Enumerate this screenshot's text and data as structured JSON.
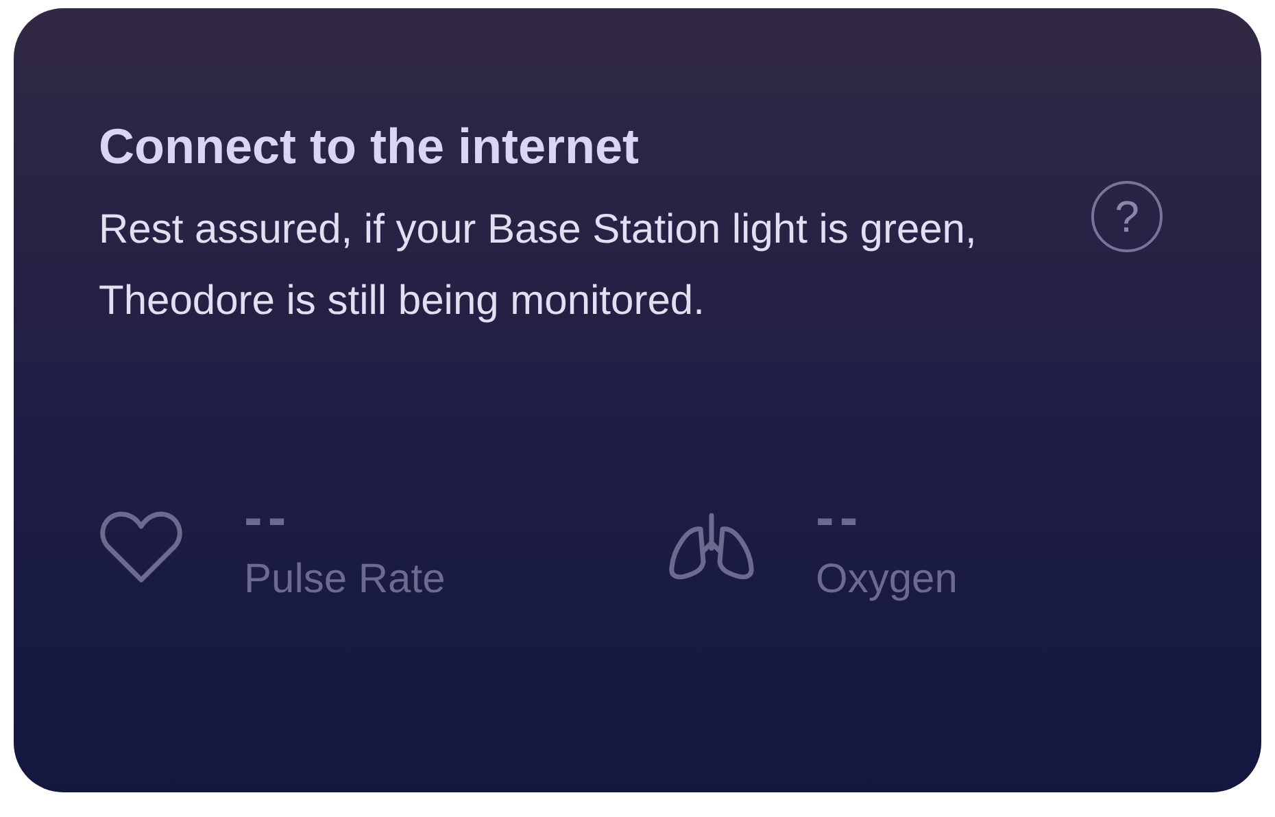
{
  "card": {
    "title": "Connect to the internet",
    "message": "Rest assured, if your Base Station light is green, Theodore is still being monitored.",
    "help_icon": "?"
  },
  "metrics": [
    {
      "kind": "heart",
      "value": "--",
      "label": "Pulse Rate"
    },
    {
      "kind": "lungs",
      "value": "--",
      "label": "Oxygen"
    }
  ]
}
